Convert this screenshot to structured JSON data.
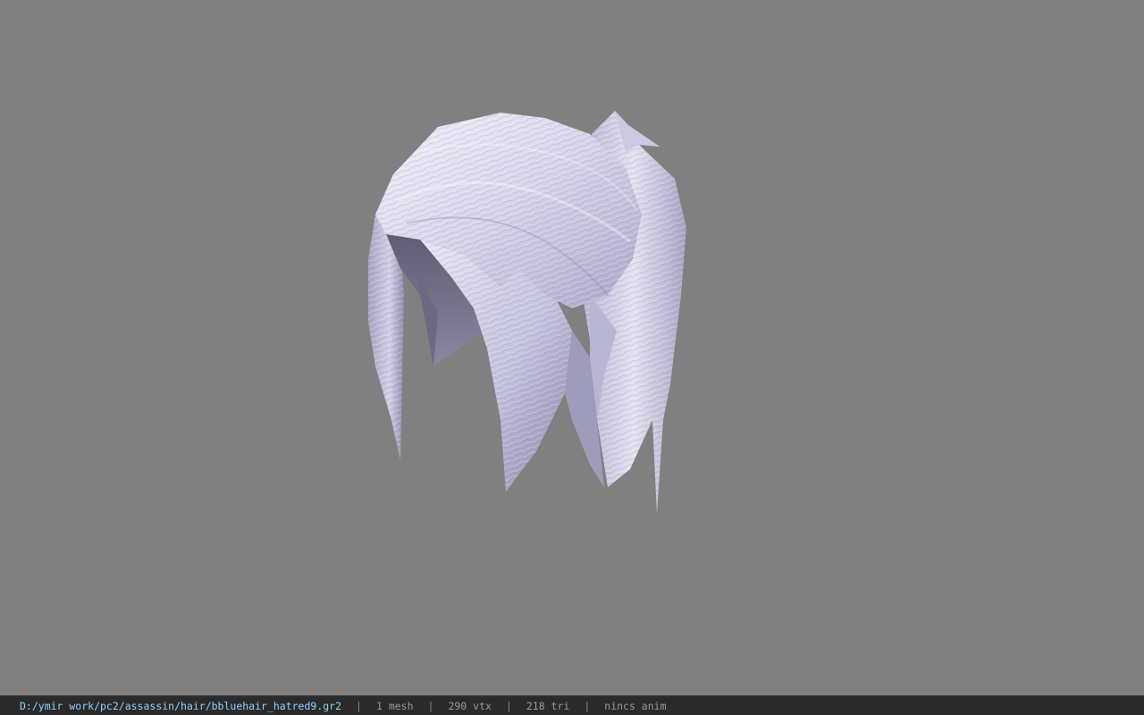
{
  "status": {
    "file_path": "D:/ymir work/pc2/assassin/hair/bbluehair_hatred9.gr2",
    "separator": "|",
    "mesh_count": "1 mesh",
    "vertex_count": "290 vtx",
    "triangle_count": "218 tri",
    "animation": "nincs anim"
  },
  "colors": {
    "background": "#808080",
    "status_bar": "#2a2a2a",
    "path_text": "#8fd0ff",
    "status_text": "#9a9a9a",
    "hair_light": "#ecebf6",
    "hair_mid": "#c5c3de",
    "hair_shadow": "#6f6c86"
  },
  "model": {
    "icon": "hair-mesh-model"
  }
}
